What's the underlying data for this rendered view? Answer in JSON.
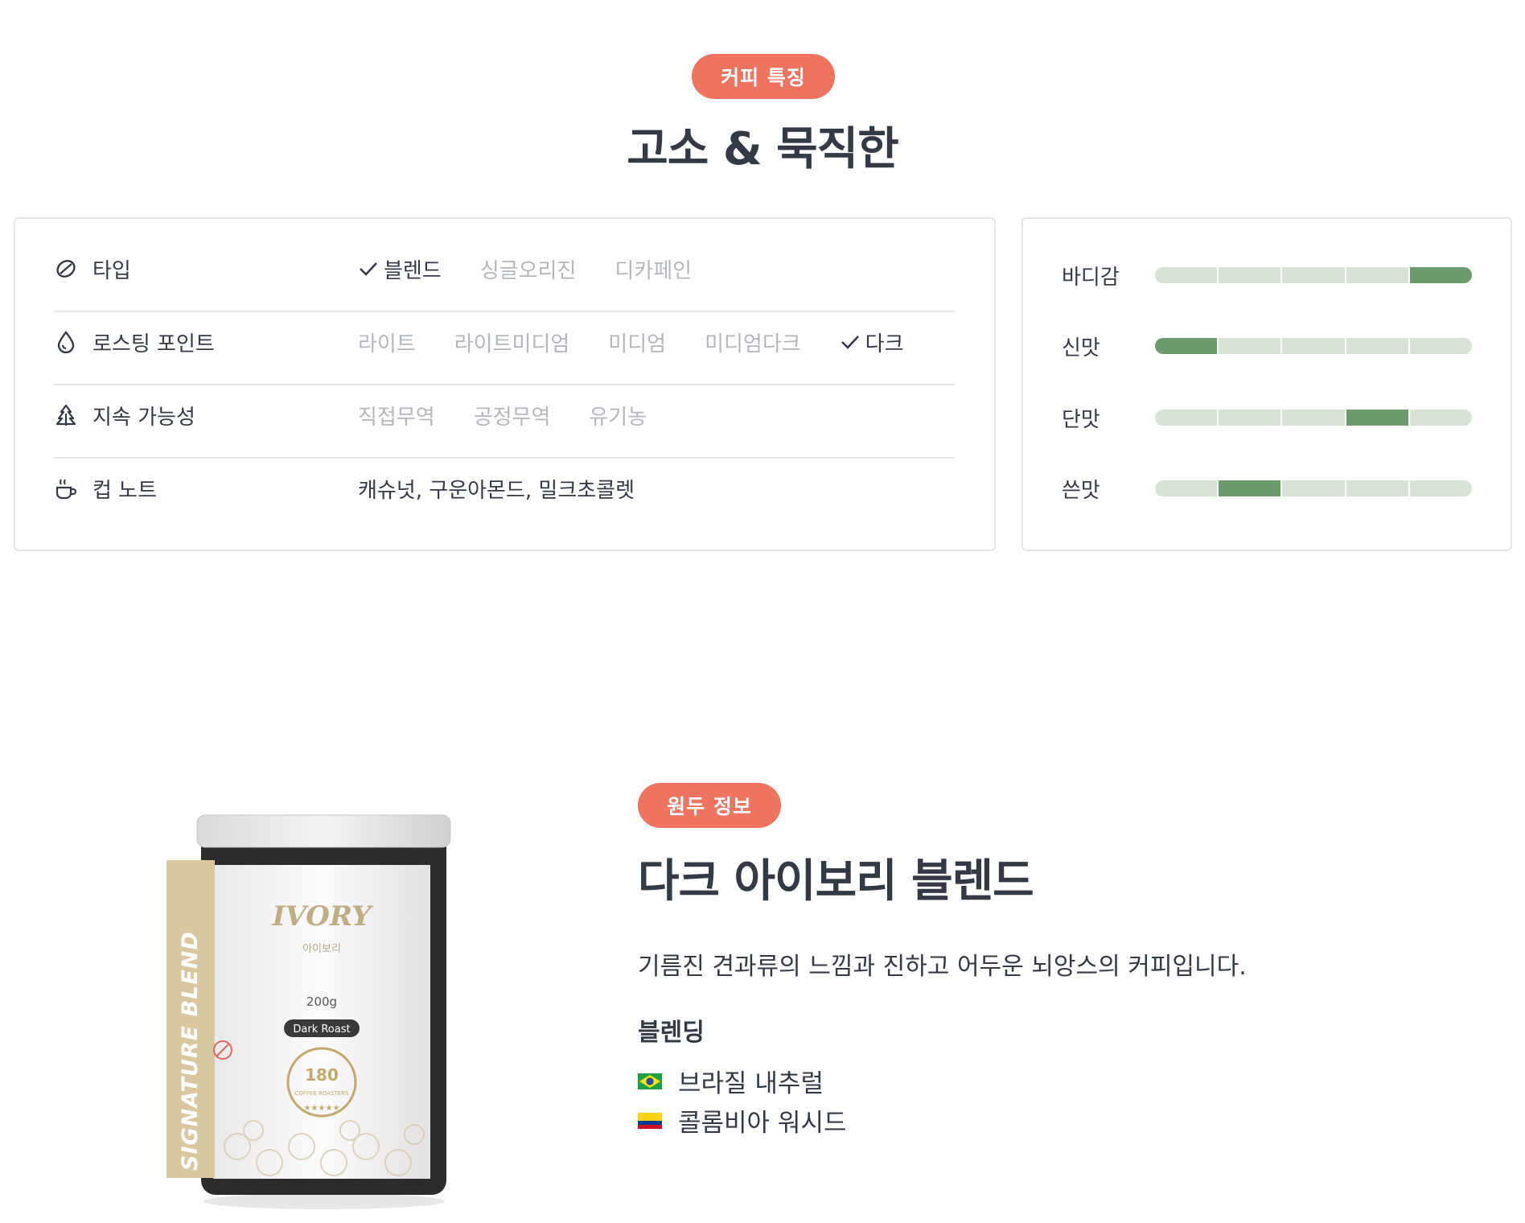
{
  "features": {
    "badge": "커피 특징",
    "title": "고소 & 묵직한",
    "rows": [
      {
        "icon": "coffee-bean-icon",
        "label": "타입",
        "options": [
          {
            "text": "블렌드",
            "selected": true
          },
          {
            "text": "싱글오리진",
            "selected": false
          },
          {
            "text": "디카페인",
            "selected": false
          }
        ]
      },
      {
        "icon": "drop-icon",
        "label": "로스팅 포인트",
        "options": [
          {
            "text": "라이트",
            "selected": false
          },
          {
            "text": "라이트미디엄",
            "selected": false
          },
          {
            "text": "미디엄",
            "selected": false
          },
          {
            "text": "미디엄다크",
            "selected": false
          },
          {
            "text": "다크",
            "selected": true
          }
        ]
      },
      {
        "icon": "tree-icon",
        "label": "지속 가능성",
        "options": [
          {
            "text": "직접무역",
            "selected": false
          },
          {
            "text": "공정무역",
            "selected": false
          },
          {
            "text": "유기농",
            "selected": false
          }
        ]
      },
      {
        "icon": "cup-icon",
        "label": "컵 노트",
        "notes": "캐슈넛, 구운아몬드, 밀크초콜렛"
      }
    ]
  },
  "taste": {
    "scale_max": 5,
    "items": [
      {
        "label": "바디감",
        "level": 5
      },
      {
        "label": "신맛",
        "level": 1
      },
      {
        "label": "단맛",
        "level": 4
      },
      {
        "label": "쓴맛",
        "level": 2
      }
    ]
  },
  "bean": {
    "badge": "원두 정보",
    "title": "다크 아이보리 블렌드",
    "description": "기름진 견과류의 느낌과 진하고 어두운 뇌앙스의 커피입니다.",
    "blend_heading": "블렌딩",
    "origins": [
      {
        "flag": "brazil-flag-icon",
        "name": "브라질 내추럴"
      },
      {
        "flag": "colombia-flag-icon",
        "name": "콜롬비아 워시드"
      }
    ]
  },
  "product": {
    "side_label": "SIGNATURE BLEND",
    "brand": "IVORY",
    "brand_kr": "아이보리",
    "weight": "200g",
    "roast": "Dark Roast",
    "logo_text": "COFFEE ROASTERS",
    "logo_number": "180"
  },
  "colors": {
    "accent": "#ef7460",
    "bar_on": "#6b9b6c",
    "bar_off": "#d6e3d6",
    "text": "#333a46",
    "muted": "#b3b7bd"
  }
}
